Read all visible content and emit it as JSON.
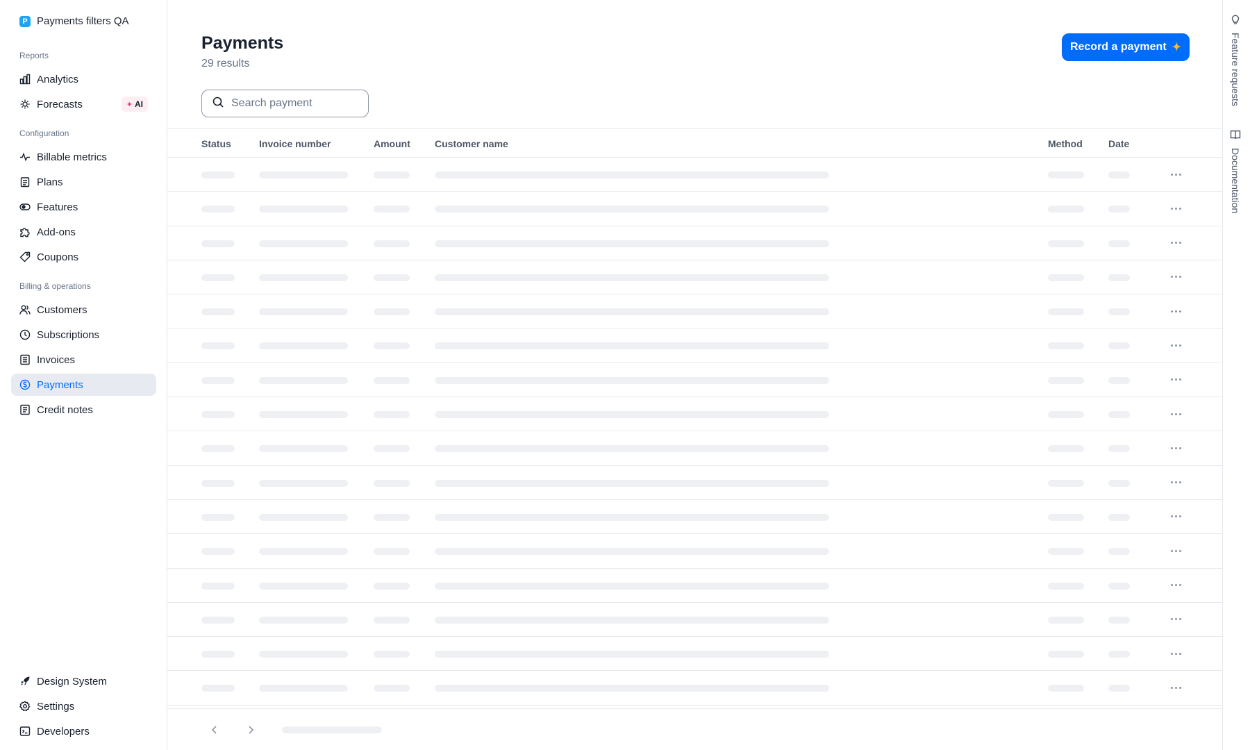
{
  "app": {
    "org_name": "Payments filters QA",
    "org_initial": "P"
  },
  "sidebar": {
    "sections": [
      {
        "title": "Reports"
      },
      {
        "title": "Configuration"
      },
      {
        "title": "Billing & operations"
      }
    ],
    "items": [
      {
        "label": "Analytics",
        "icon": "analytics-icon"
      },
      {
        "label": "Forecasts",
        "icon": "forecasts-icon",
        "badge": "AI"
      },
      {
        "label": "Billable metrics",
        "icon": "pulse-icon"
      },
      {
        "label": "Plans",
        "icon": "clipboard-icon"
      },
      {
        "label": "Features",
        "icon": "toggle-icon"
      },
      {
        "label": "Add-ons",
        "icon": "puzzle-icon"
      },
      {
        "label": "Coupons",
        "icon": "tag-icon"
      },
      {
        "label": "Customers",
        "icon": "users-icon"
      },
      {
        "label": "Subscriptions",
        "icon": "clock-icon"
      },
      {
        "label": "Invoices",
        "icon": "document-icon"
      },
      {
        "label": "Payments",
        "icon": "dollar-circle-icon",
        "active": true
      },
      {
        "label": "Credit notes",
        "icon": "receipt-icon"
      }
    ],
    "bottom_items": [
      {
        "label": "Design System",
        "icon": "rocket-icon"
      },
      {
        "label": "Settings",
        "icon": "gear-icon"
      },
      {
        "label": "Developers",
        "icon": "terminal-icon"
      }
    ]
  },
  "main": {
    "title": "Payments",
    "result_count": "29 results",
    "record_button": "Record a payment",
    "search_placeholder": "Search payment",
    "columns": [
      "Status",
      "Invoice number",
      "Amount",
      "Customer name",
      "Method",
      "Date"
    ],
    "loading_rows": 16
  },
  "rail": {
    "feature_requests": "Feature requests",
    "documentation": "Documentation"
  },
  "colors": {
    "accent": "#006cfa",
    "skeleton": "#eef0f3",
    "active_bg": "#e7ebf1"
  }
}
